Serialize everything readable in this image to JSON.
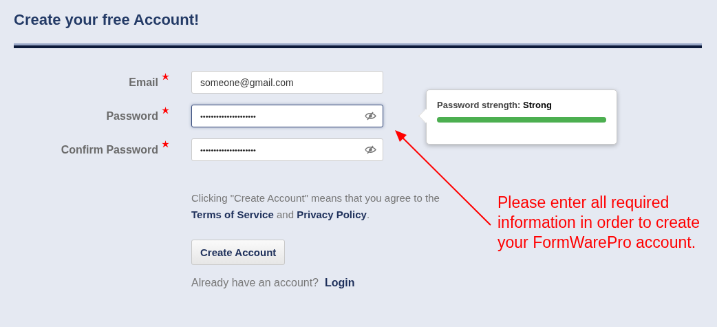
{
  "title": "Create your free Account!",
  "fields": [
    {
      "label": "Email",
      "required": true,
      "value": "someone@gmail.com",
      "kind": "text",
      "focused": false
    },
    {
      "label": "Password",
      "required": true,
      "value": "•••••••••••••••••••••",
      "kind": "password",
      "focused": true
    },
    {
      "label": "Confirm Password",
      "required": true,
      "value": "•••••••••••••••••••••",
      "kind": "password",
      "focused": false
    }
  ],
  "strength_popover": {
    "text": "Password strength: **Strong**",
    "level": 1.0
  },
  "agreement": {
    "before": "Clicking \"Create Account\" means that you agree to the",
    "terms_link": "Terms of Service",
    "middle": "and",
    "privacy_link": "Privacy Policy",
    "after": "."
  },
  "create_button": "Create Account",
  "login_prompt": {
    "text": "Already have an account?",
    "link": "Login"
  },
  "annotation": "Please enter all required information in order to create your FormWarePro account."
}
